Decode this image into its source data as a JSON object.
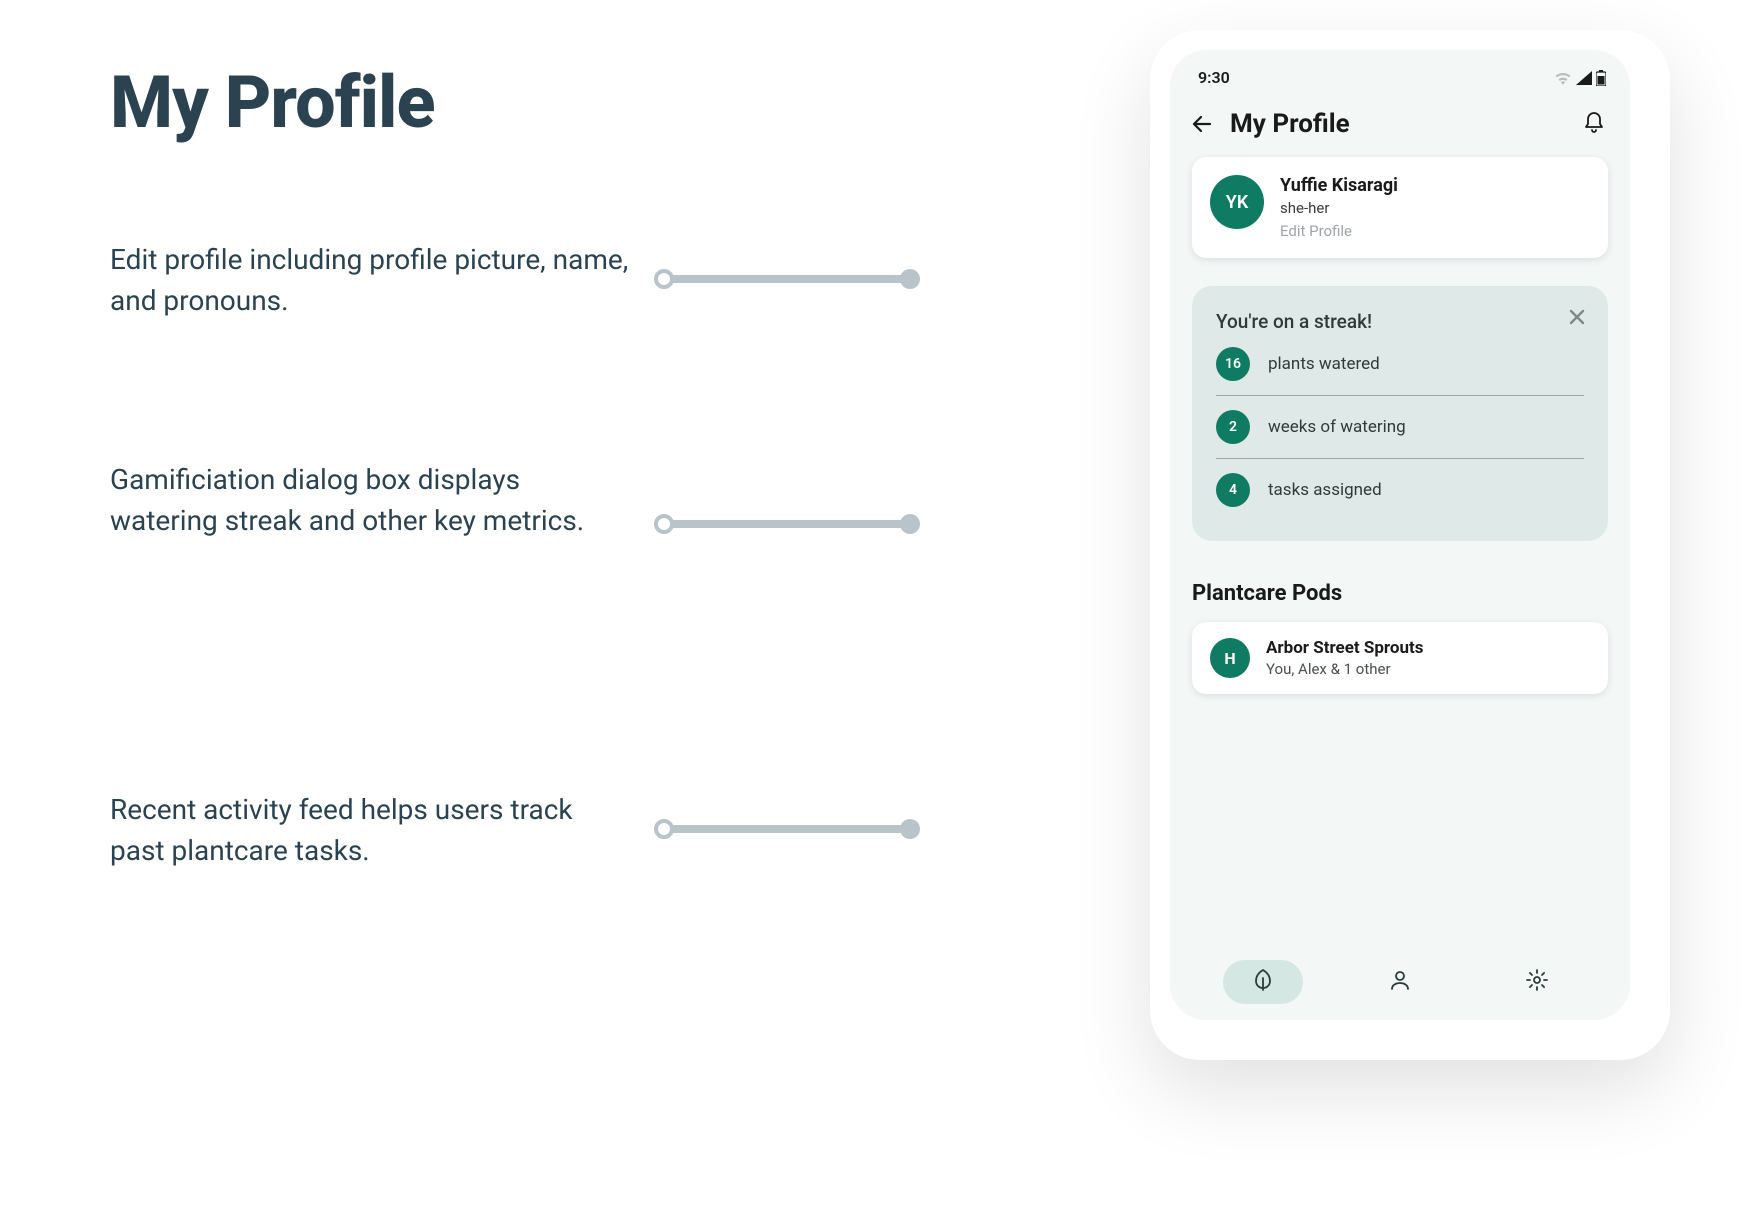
{
  "page": {
    "title": "My Profile",
    "annotations": [
      "Edit profile including profile picture, name, and pronouns.",
      "Gamificiation dialog box displays watering streak and other key metrics.",
      "Recent activity feed helps users track past plantcare tasks."
    ]
  },
  "phone": {
    "status_time": "9:30",
    "app_bar_title": "My Profile",
    "profile": {
      "initials": "YK",
      "name": "Yuffie Kisaragi",
      "pronouns": "she-her",
      "edit_label": "Edit Profile"
    },
    "streak": {
      "title": "You're on a streak!",
      "metrics": [
        {
          "value": "16",
          "label": "plants watered"
        },
        {
          "value": "2",
          "label": "weeks of watering"
        },
        {
          "value": "4",
          "label": "tasks assigned"
        }
      ]
    },
    "pods": {
      "section_title": "Plantcare Pods",
      "items": [
        {
          "initial": "H",
          "name": "Arbor Street Sprouts",
          "members": "You, Alex & 1 other"
        }
      ]
    }
  },
  "colors": {
    "accent": "#0f7b62",
    "text_dark": "#2b4350",
    "muted": "#b8c4ca"
  }
}
